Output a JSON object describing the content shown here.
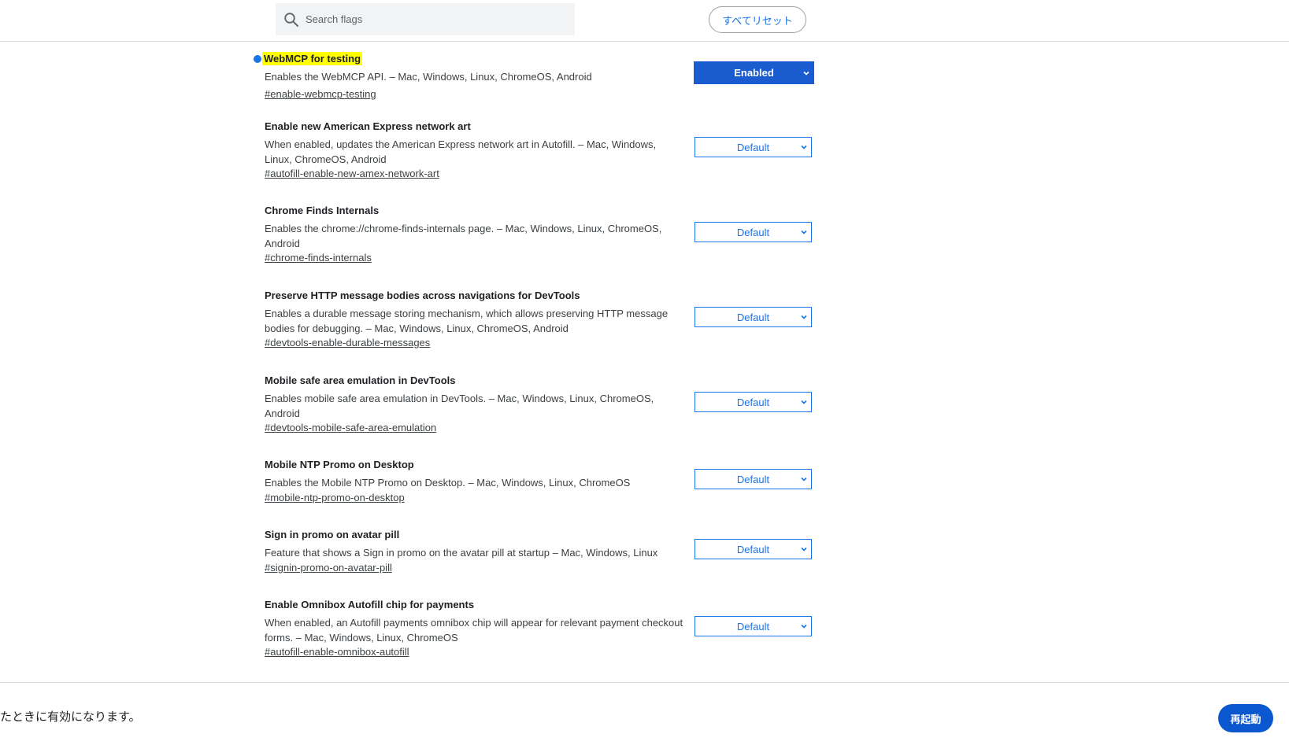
{
  "search": {
    "placeholder": "Search flags",
    "value": ""
  },
  "header": {
    "reset_all_label": "すべてリセット"
  },
  "flags": [
    {
      "title": "WebMCP for testing",
      "description": "Enables the WebMCP API. – Mac, Windows, Linux, ChromeOS, Android",
      "link": "#enable-webmcp-testing",
      "state": "Enabled",
      "modified": true
    },
    {
      "title": "Enable new American Express network art",
      "description": "When enabled, updates the American Express network art in Autofill. – Mac, Windows, Linux, ChromeOS, Android",
      "link": "#autofill-enable-new-amex-network-art",
      "state": "Default"
    },
    {
      "title": "Chrome Finds Internals",
      "description": "Enables the chrome://chrome-finds-internals page. – Mac, Windows, Linux, ChromeOS, Android",
      "link": "#chrome-finds-internals",
      "state": "Default"
    },
    {
      "title": "Preserve HTTP message bodies across navigations for DevTools",
      "description": "Enables a durable message storing mechanism, which allows preserving HTTP message bodies for debugging. – Mac, Windows, Linux, ChromeOS, Android",
      "link": "#devtools-enable-durable-messages",
      "state": "Default"
    },
    {
      "title": "Mobile safe area emulation in DevTools",
      "description": "Enables mobile safe area emulation in DevTools. – Mac, Windows, Linux, ChromeOS, Android",
      "link": "#devtools-mobile-safe-area-emulation",
      "state": "Default"
    },
    {
      "title": "Mobile NTP Promo on Desktop",
      "description": "Enables the Mobile NTP Promo on Desktop. – Mac, Windows, Linux, ChromeOS",
      "link": "#mobile-ntp-promo-on-desktop",
      "state": "Default"
    },
    {
      "title": "Sign in promo on avatar pill",
      "description": "Feature that shows a Sign in promo on the avatar pill at startup – Mac, Windows, Linux",
      "link": "#signin-promo-on-avatar-pill",
      "state": "Default"
    },
    {
      "title": "Enable Omnibox Autofill chip for payments",
      "description": "When enabled, an Autofill payments omnibox chip will appear for relevant payment checkout forms. – Mac, Windows, Linux, ChromeOS",
      "link": "#autofill-enable-omnibox-autofill",
      "state": "Default"
    }
  ],
  "footer": {
    "message": "たときに有効になります。",
    "relaunch_label": "再起動"
  },
  "colors": {
    "accent": "#1a73e8",
    "enabled_bg": "#1a5bd0",
    "relaunch_bg": "#0b57d0",
    "highlight": "#ffff00"
  }
}
